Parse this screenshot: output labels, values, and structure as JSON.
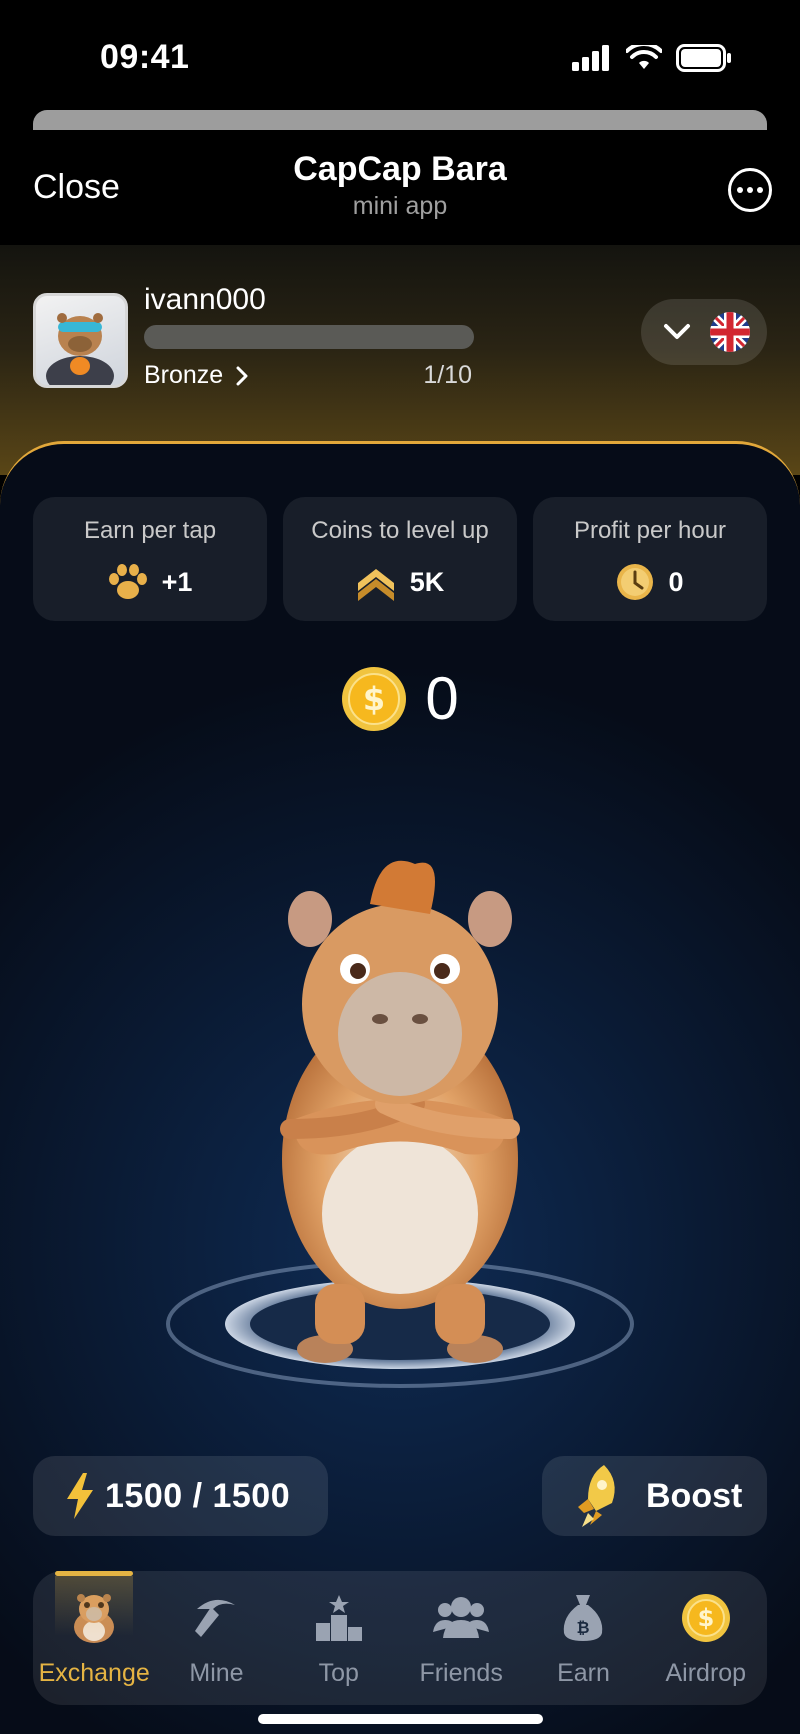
{
  "status_bar": {
    "time": "09:41"
  },
  "header": {
    "close_label": "Close",
    "title": "CapCap Bara",
    "subtitle": "mini app"
  },
  "profile": {
    "username": "ivann000",
    "rank": "Bronze",
    "level_progress": "1/10",
    "progress_fraction": 0.0,
    "language_flag": "uk-flag-icon"
  },
  "stats": [
    {
      "label": "Earn per tap",
      "value": "+1",
      "icon": "paw-icon"
    },
    {
      "label": "Coins to level up",
      "value": "5K",
      "icon": "chevrons-up-icon"
    },
    {
      "label": "Profit per hour",
      "value": "0",
      "icon": "clock-coin-icon"
    }
  ],
  "balance": {
    "value": "0"
  },
  "energy": {
    "value": "1500 / 1500"
  },
  "boost": {
    "label": "Boost"
  },
  "nav": [
    {
      "label": "Exchange",
      "icon": "capybara-icon",
      "active": true
    },
    {
      "label": "Mine",
      "icon": "pickaxe-icon",
      "active": false
    },
    {
      "label": "Top",
      "icon": "podium-icon",
      "active": false
    },
    {
      "label": "Friends",
      "icon": "friends-icon",
      "active": false
    },
    {
      "label": "Earn",
      "icon": "money-bag-icon",
      "active": false
    },
    {
      "label": "Airdrop",
      "icon": "coin-icon",
      "active": false
    }
  ],
  "colors": {
    "accent": "#e5b443",
    "panel_bg": "#0a1a33",
    "header_bg": "#000000"
  }
}
